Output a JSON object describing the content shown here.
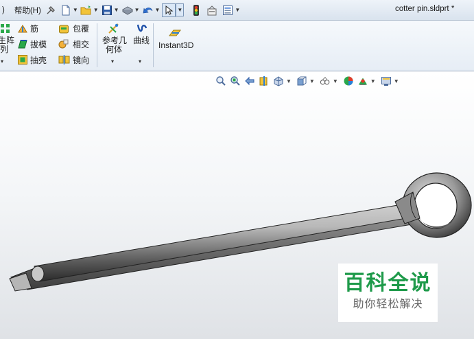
{
  "menubar": {
    "partial_menu": ")",
    "help_menu": "帮助(H)",
    "document_title": "cotter pin.sldprt *"
  },
  "ribbon": {
    "linear_pattern": [
      "生阵",
      "列"
    ],
    "rib": "筋",
    "draft": "拔模",
    "shell": "抽壳",
    "wrap": "包覆",
    "intersect": "相交",
    "mirror": "镜向",
    "reference_geometry": [
      "参考几",
      "何体"
    ],
    "curves": "曲线",
    "instant3d": "Instant3D"
  },
  "watermark": {
    "main": "百科全说",
    "sub": "助你轻松解决"
  },
  "colors": {
    "accent_green": "#1e9a4a",
    "model_steel": "#9a9a9a"
  }
}
